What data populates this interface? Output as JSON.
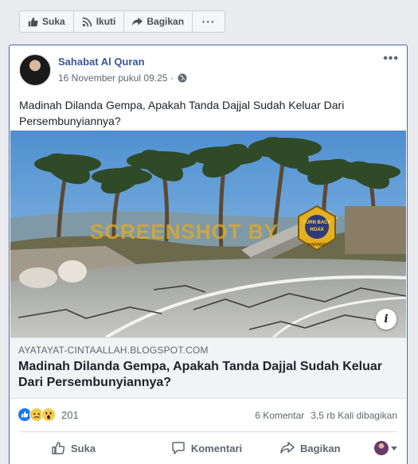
{
  "page_actions": {
    "like_label": "Suka",
    "follow_label": "Ikuti",
    "share_label": "Bagikan",
    "more_label": "···"
  },
  "post": {
    "author": "Sahabat Al Quran",
    "timestamp": "16 November pukul 09.25 ·",
    "menu_label": "•••",
    "text": "Madinah Dilanda Gempa, Apakah Tanda Dajjal Sudah Keluar Dari Persembunyiannya?"
  },
  "link_preview": {
    "watermark": "SCREENSHOT BY",
    "badge_text": "TURN BACK HOAX",
    "badge_sub": "MAFINDO",
    "info_label": "i",
    "domain": "AYATAYAT-CINTAALLAH.BLOGSPOT.COM",
    "title": "Madinah Dilanda Gempa, Apakah Tanda Dajjal Sudah Keluar Dari Persembunyiannya?"
  },
  "reactions": {
    "icons": [
      "like-reaction-icon",
      "sad-reaction-icon",
      "wow-reaction-icon"
    ],
    "count": "201",
    "comments": "6 Komentar",
    "shares": "3,5 rb Kali dibagikan"
  },
  "actions": {
    "like_label": "Suka",
    "comment_label": "Komentari",
    "share_label": "Bagikan"
  },
  "colors": {
    "link_blue": "#385898",
    "facebook_blue": "#4267b2",
    "watermark_gold": "#e6aa1e"
  }
}
